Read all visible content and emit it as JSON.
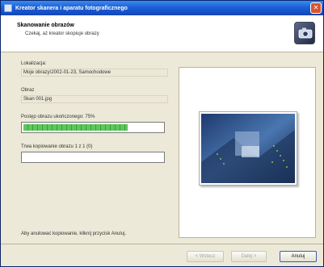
{
  "window": {
    "title": "Kreator skanera i aparatu fotograficznego"
  },
  "header": {
    "title": "Skanowanie obrazów",
    "subtitle": "Czekaj, aż kreator skopiuje obrazy"
  },
  "fields": {
    "location_label": "Lokalizacja:",
    "location_value": "Moje obrazy\\2002-01-23, Samochodowe",
    "image_label": "Obraz",
    "image_value": "Skan 001.jpg"
  },
  "progress": {
    "copy_label": "Postęp obrazu ukończonego: 75%",
    "copy_percent": 75,
    "overall_label": "Trwa kopiowanie obrazu 1 z 1 (0)",
    "overall_percent": 0
  },
  "footer_note": "Aby anulować kopiowanie, kliknij przycisk Anuluj.",
  "buttons": {
    "back": "< Wstecz",
    "next": "Dalej >",
    "cancel": "Anuluj"
  },
  "colors": {
    "titlebar": "#1b5fd6",
    "progress": "#5cc85a"
  }
}
